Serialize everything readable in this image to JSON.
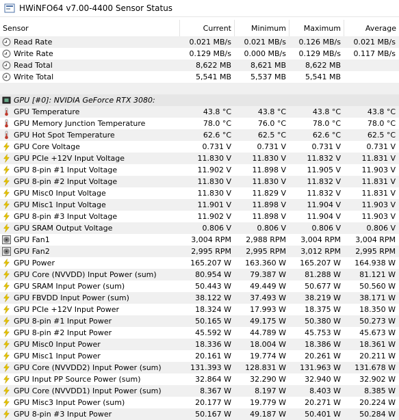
{
  "window": {
    "title": "HWiNFO64 v7.00-4400 Sensor Status"
  },
  "columns": {
    "sensor": "Sensor",
    "current": "Current",
    "minimum": "Minimum",
    "maximum": "Maximum",
    "average": "Average"
  },
  "colors": {
    "clock": "#7a7a7a",
    "thermo": "#c0392b",
    "bolt": "#e7c400",
    "fan": "#555555",
    "group_bg": "#e6e6e6"
  },
  "rows": [
    {
      "icon": "clock-icon",
      "name": "Read Rate",
      "cur": "0.021 MB/s",
      "min": "0.021 MB/s",
      "max": "0.126 MB/s",
      "avg": "0.021 MB/s"
    },
    {
      "icon": "clock-icon",
      "name": "Write Rate",
      "cur": "0.129 MB/s",
      "min": "0.000 MB/s",
      "max": "0.129 MB/s",
      "avg": "0.117 MB/s"
    },
    {
      "icon": "clock-icon",
      "name": "Read Total",
      "cur": "8,622 MB",
      "min": "8,621 MB",
      "max": "8,622 MB",
      "avg": ""
    },
    {
      "icon": "clock-icon",
      "name": "Write Total",
      "cur": "5,541 MB",
      "min": "5,537 MB",
      "max": "5,541 MB",
      "avg": ""
    },
    {
      "type": "empty"
    },
    {
      "type": "group",
      "icon": "gpu-chip-icon",
      "name": "GPU [#0]: NVIDIA GeForce RTX 3080:"
    },
    {
      "icon": "thermometer-icon",
      "name": "GPU Temperature",
      "cur": "43.8 °C",
      "min": "43.8 °C",
      "max": "43.8 °C",
      "avg": "43.8 °C"
    },
    {
      "icon": "thermometer-icon",
      "name": "GPU Memory Junction Temperature",
      "cur": "78.0 °C",
      "min": "76.0 °C",
      "max": "78.0 °C",
      "avg": "78.0 °C"
    },
    {
      "icon": "thermometer-icon",
      "name": "GPU Hot Spot Temperature",
      "cur": "62.6 °C",
      "min": "62.5 °C",
      "max": "62.6 °C",
      "avg": "62.5 °C"
    },
    {
      "icon": "bolt-icon",
      "name": "GPU Core Voltage",
      "cur": "0.731 V",
      "min": "0.731 V",
      "max": "0.731 V",
      "avg": "0.731 V"
    },
    {
      "icon": "bolt-icon",
      "name": "GPU PCIe +12V Input Voltage",
      "cur": "11.830 V",
      "min": "11.830 V",
      "max": "11.832 V",
      "avg": "11.831 V"
    },
    {
      "icon": "bolt-icon",
      "name": "GPU 8-pin #1 Input Voltage",
      "cur": "11.902 V",
      "min": "11.898 V",
      "max": "11.905 V",
      "avg": "11.903 V"
    },
    {
      "icon": "bolt-icon",
      "name": "GPU 8-pin #2 Input Voltage",
      "cur": "11.830 V",
      "min": "11.830 V",
      "max": "11.832 V",
      "avg": "11.831 V"
    },
    {
      "icon": "bolt-icon",
      "name": "GPU Misc0 Input Voltage",
      "cur": "11.830 V",
      "min": "11.829 V",
      "max": "11.832 V",
      "avg": "11.831 V"
    },
    {
      "icon": "bolt-icon",
      "name": "GPU Misc1 Input Voltage",
      "cur": "11.901 V",
      "min": "11.898 V",
      "max": "11.904 V",
      "avg": "11.903 V"
    },
    {
      "icon": "bolt-icon",
      "name": "GPU 8-pin #3 Input Voltage",
      "cur": "11.902 V",
      "min": "11.898 V",
      "max": "11.904 V",
      "avg": "11.903 V"
    },
    {
      "icon": "bolt-icon",
      "name": "GPU SRAM Output Voltage",
      "cur": "0.806 V",
      "min": "0.806 V",
      "max": "0.806 V",
      "avg": "0.806 V"
    },
    {
      "icon": "fan-icon",
      "name": "GPU Fan1",
      "cur": "3,004 RPM",
      "min": "2,988 RPM",
      "max": "3,004 RPM",
      "avg": "3,004 RPM"
    },
    {
      "icon": "fan-icon",
      "name": "GPU Fan2",
      "cur": "2,995 RPM",
      "min": "2,995 RPM",
      "max": "3,012 RPM",
      "avg": "2,995 RPM"
    },
    {
      "icon": "bolt-icon",
      "name": "GPU Power",
      "cur": "165.207 W",
      "min": "163.360 W",
      "max": "165.207 W",
      "avg": "164.938 W"
    },
    {
      "icon": "bolt-icon",
      "name": "GPU Core (NVVDD) Input Power (sum)",
      "cur": "80.954 W",
      "min": "79.387 W",
      "max": "81.288 W",
      "avg": "81.121 W"
    },
    {
      "icon": "bolt-icon",
      "name": "GPU SRAM Input Power (sum)",
      "cur": "50.443 W",
      "min": "49.449 W",
      "max": "50.677 W",
      "avg": "50.560 W"
    },
    {
      "icon": "bolt-icon",
      "name": "GPU FBVDD Input Power (sum)",
      "cur": "38.122 W",
      "min": "37.493 W",
      "max": "38.219 W",
      "avg": "38.171 W"
    },
    {
      "icon": "bolt-icon",
      "name": "GPU PCIe +12V Input Power",
      "cur": "18.324 W",
      "min": "17.993 W",
      "max": "18.375 W",
      "avg": "18.350 W"
    },
    {
      "icon": "bolt-icon",
      "name": "GPU 8-pin #1 Input Power",
      "cur": "50.165 W",
      "min": "49.175 W",
      "max": "50.380 W",
      "avg": "50.273 W"
    },
    {
      "icon": "bolt-icon",
      "name": "GPU 8-pin #2 Input Power",
      "cur": "45.592 W",
      "min": "44.789 W",
      "max": "45.753 W",
      "avg": "45.673 W"
    },
    {
      "icon": "bolt-icon",
      "name": "GPU Misc0 Input Power",
      "cur": "18.336 W",
      "min": "18.004 W",
      "max": "18.386 W",
      "avg": "18.361 W"
    },
    {
      "icon": "bolt-icon",
      "name": "GPU Misc1 Input Power",
      "cur": "20.161 W",
      "min": "19.774 W",
      "max": "20.261 W",
      "avg": "20.211 W"
    },
    {
      "icon": "bolt-icon",
      "name": "GPU Core (NVVDD2) Input Power (sum)",
      "cur": "131.393 W",
      "min": "128.831 W",
      "max": "131.963 W",
      "avg": "131.678 W"
    },
    {
      "icon": "bolt-icon",
      "name": "GPU Input PP Source Power (sum)",
      "cur": "32.864 W",
      "min": "32.290 W",
      "max": "32.940 W",
      "avg": "32.902 W"
    },
    {
      "icon": "bolt-icon",
      "name": "GPU Core (NVVDD1) Input Power (sum)",
      "cur": "8.367 W",
      "min": "8.197 W",
      "max": "8.403 W",
      "avg": "8.385 W"
    },
    {
      "icon": "bolt-icon",
      "name": "GPU Misc3 Input Power (sum)",
      "cur": "20.177 W",
      "min": "19.779 W",
      "max": "20.271 W",
      "avg": "20.224 W"
    },
    {
      "icon": "bolt-icon",
      "name": "GPU 8-pin #3 Input Power",
      "cur": "50.167 W",
      "min": "49.187 W",
      "max": "50.401 W",
      "avg": "50.284 W"
    }
  ]
}
